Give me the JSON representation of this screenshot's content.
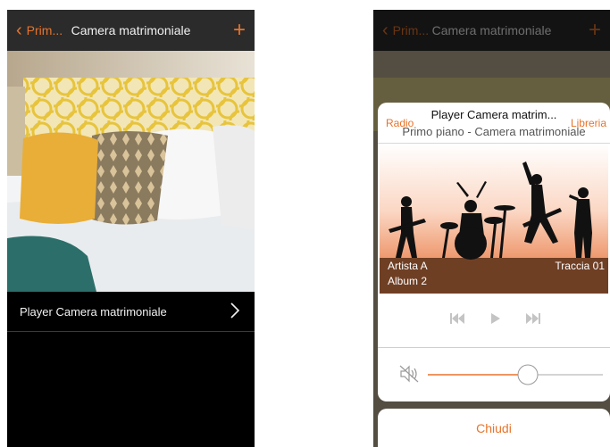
{
  "left_screen": {
    "nav": {
      "back_label": "Prim...",
      "title": "Camera matrimoniale",
      "add_icon": "plus-icon"
    },
    "row": {
      "label": "Player Camera matrimoniale",
      "chevron_icon": "chevron-right-icon"
    }
  },
  "right_screen": {
    "nav": {
      "back_label": "Prim...",
      "title": "Camera matrimoniale",
      "add_icon": "plus-icon"
    },
    "player": {
      "title": "Player Camera matrim...",
      "subtitle": "Primo piano - Camera matrimoniale",
      "radio_label": "Radio",
      "library_label": "Libreria",
      "artist": "Artista A",
      "album": "Album 2",
      "track": "Traccia 01",
      "controls": [
        "previous-icon",
        "play-icon",
        "next-icon"
      ],
      "volume_icon": "speaker-muted-icon",
      "volume_level": 0.57
    },
    "close_label": "Chiudi"
  },
  "colors": {
    "accent": "#e8732a",
    "navbar": "#2b2b2b"
  }
}
